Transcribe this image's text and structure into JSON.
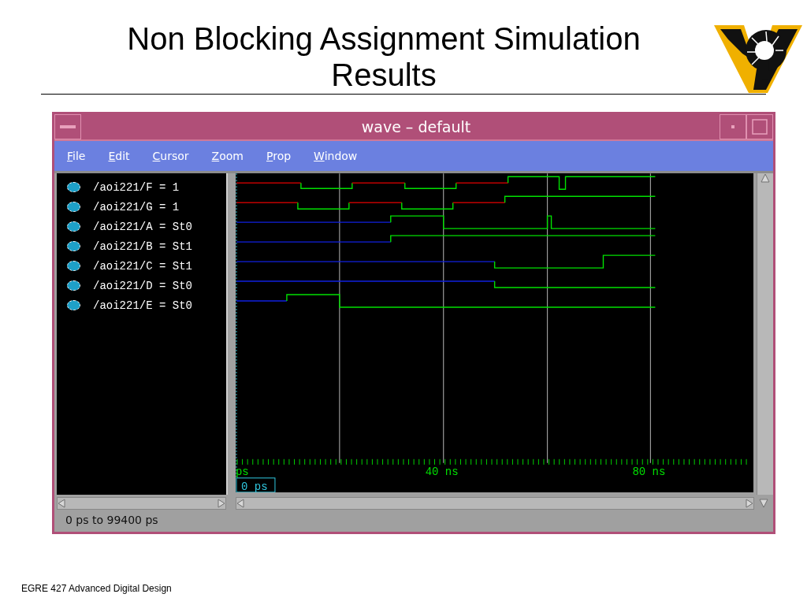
{
  "slide": {
    "title": "Non Blocking Assignment Simulation Results",
    "footer": "EGRE 427 Advanced Digital Design"
  },
  "window": {
    "title": "wave – default"
  },
  "menu": [
    {
      "key": "F",
      "rest": "ile"
    },
    {
      "key": "E",
      "rest": "dit"
    },
    {
      "key": "C",
      "rest": "ursor"
    },
    {
      "key": "Z",
      "rest": "oom"
    },
    {
      "key": "P",
      "rest": "rop"
    },
    {
      "key": "W",
      "rest": "indow"
    }
  ],
  "signals": [
    "/aoi221/F = 1",
    "/aoi221/G = 1",
    "/aoi221/A = St0",
    "/aoi221/B = St1",
    "/aoi221/C = St1",
    "/aoi221/D = St0",
    "/aoi221/E = St0"
  ],
  "ruler": {
    "start": "ps",
    "labels": [
      "40 ns",
      "80 ns"
    ],
    "cursor": "0 ps"
  },
  "status_bar": "0 ps to 99400 ps"
}
